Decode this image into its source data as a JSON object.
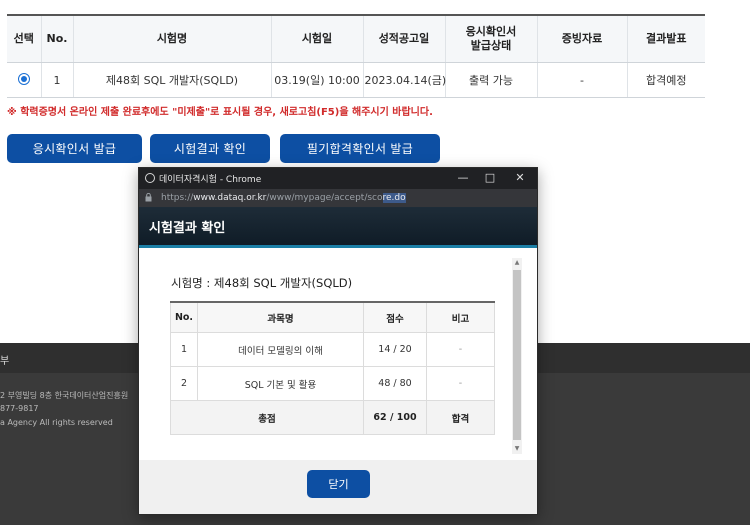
{
  "exam_table": {
    "headers": [
      "선택",
      "No.",
      "시험명",
      "시험일",
      "성적공고일",
      "응시확인서\n발급상태",
      "증빙자료",
      "결과발표"
    ],
    "rows": [
      {
        "no": "1",
        "name": "제48회 SQL 개발자(SQLD)",
        "date": "03.19(일) 10:00",
        "announce_date": "2023.04.14(금)",
        "issue_status": "출력 가능",
        "evidence": "-",
        "result": "합격예정"
      }
    ]
  },
  "notice": "※ 학력증명서 온라인 제출 완료후에도 \"미제출\"로 표시될 경우, 새로고침(F5)을 해주시기 바랍니다.",
  "buttons": {
    "confirm_issue": "응시확인서 발급",
    "check_result": "시험결과 확인",
    "written_pass_issue": "필기합격확인서 발급"
  },
  "footer": {
    "bar_text": "부",
    "line1": "2 부영빌딩 8층 한국데이터산업진흥원",
    "line2": "877-9817",
    "line3": "a Agency All rights reserved"
  },
  "popup": {
    "window_title": "데이터자격시험 - Chrome",
    "url_prefix": "https://",
    "url_domain": "www.dataq.or.kr",
    "url_path": "/www/mypage/accept/sco",
    "url_selected": "re.do",
    "header_title": "시험결과 확인",
    "exam_name": "시험명 : 제48회 SQL 개발자(SQLD)",
    "table": {
      "headers": [
        "No.",
        "과목명",
        "점수",
        "비고"
      ],
      "rows": [
        {
          "no": "1",
          "subject": "데이터 모델링의 이해",
          "score": "14 / 20",
          "note": "-"
        },
        {
          "no": "2",
          "subject": "SQL 기본 및 활용",
          "score": "48 / 80",
          "note": "-"
        }
      ],
      "total": {
        "label": "총점",
        "score": "62 / 100",
        "note": "합격"
      }
    },
    "close_label": "닫기"
  },
  "colors": {
    "primary_blue": "#0d4fa3",
    "notice_red": "#d12b2b",
    "radio_blue": "#1a6fd4"
  }
}
